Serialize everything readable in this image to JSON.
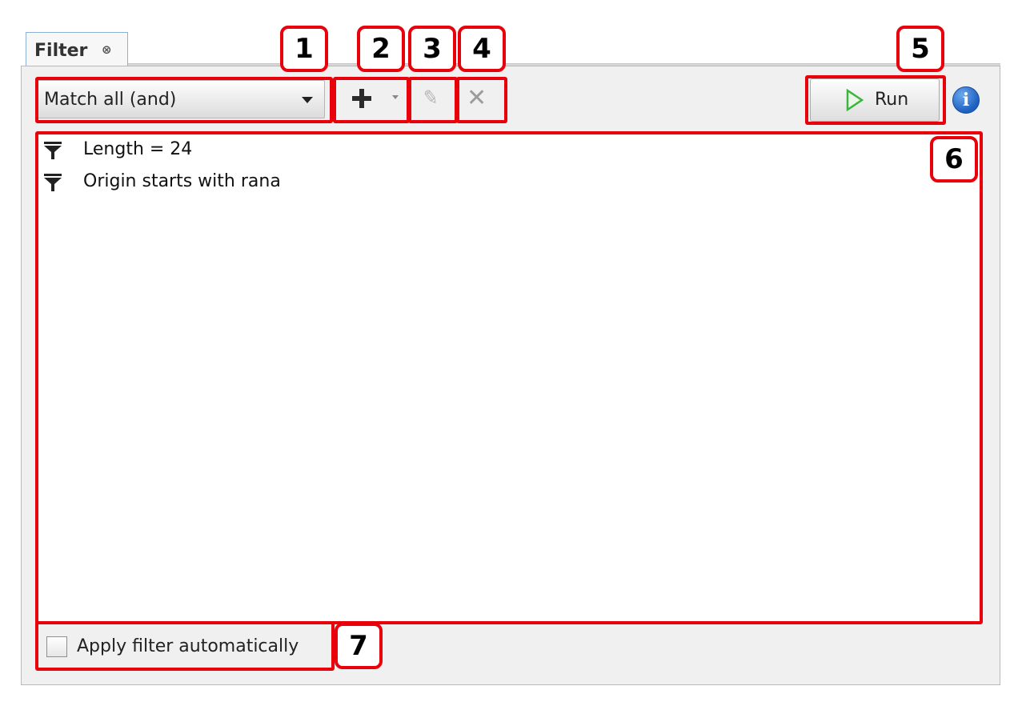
{
  "tab": {
    "label": "Filter",
    "close_glyph": "⊗"
  },
  "toolbar": {
    "match_mode": "Match all (and)",
    "add_icon": "plus-icon",
    "edit_icon": "pencil-icon",
    "delete_icon": "x-icon",
    "delete_glyph": "✕",
    "edit_glyph": "✎",
    "run_label": "Run",
    "info_glyph": "i"
  },
  "filters": [
    {
      "text": "Length = 24"
    },
    {
      "text": "Origin starts with rana"
    }
  ],
  "auto_apply": {
    "label": "Apply filter automatically",
    "checked": false
  },
  "annotations": [
    "1",
    "2",
    "3",
    "4",
    "5",
    "6",
    "7"
  ],
  "colors": {
    "annotation": "#e8000b",
    "run_play": "#3cb53c",
    "info": "#1d5fbf"
  }
}
